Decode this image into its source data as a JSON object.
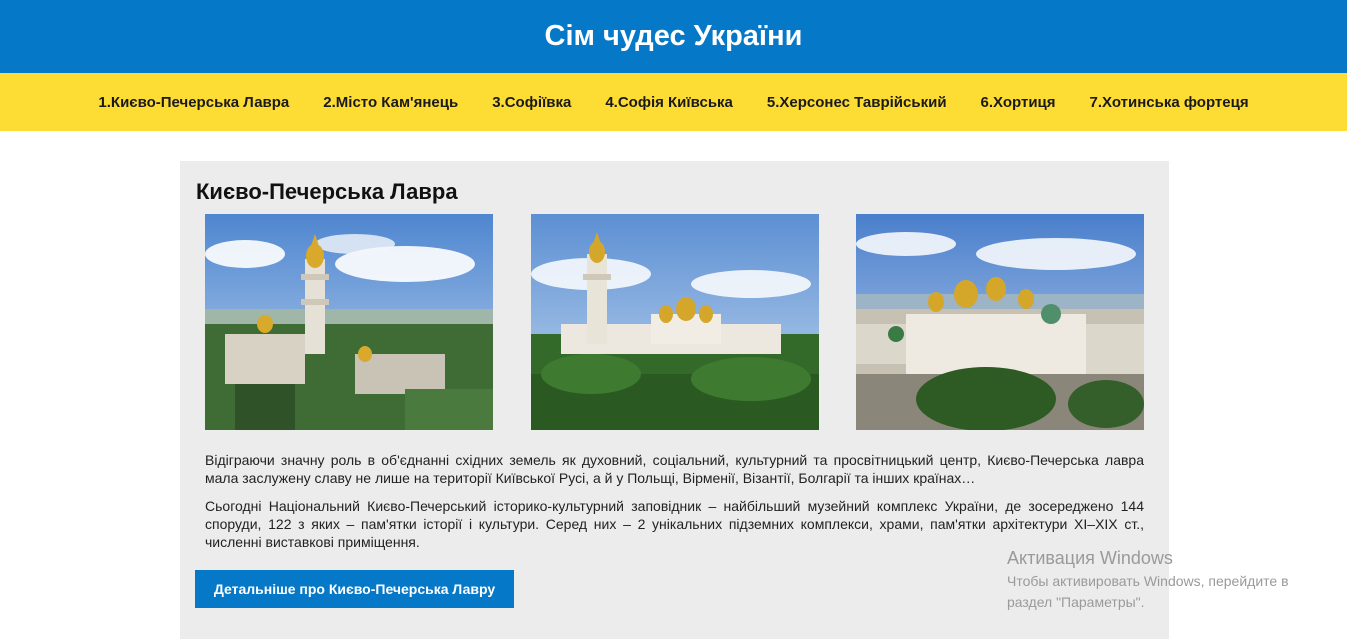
{
  "header": {
    "title": "Сім чудес України"
  },
  "nav": {
    "items": [
      {
        "label": "1.Києво-Печерська Лавра"
      },
      {
        "label": "2.Місто Кам'янець"
      },
      {
        "label": "3.Софіївка"
      },
      {
        "label": "4.Софія Київська"
      },
      {
        "label": "5.Херсонес Таврійський"
      },
      {
        "label": "6.Хортиця"
      },
      {
        "label": "7.Хотинська фортеця"
      }
    ]
  },
  "main": {
    "title": "Києво-Печерська Лавра",
    "paragraphs": [
      "Відіграючи значну роль в об'єднанні східних земель як духовний, соціальний, культурний та просвітницький центр, Києво-Печерська лавра мала заслужену славу не лише на території Київської Русі, а й у Польщі, Вірменії, Візантії, Болгарії та інших країнах…",
      "Сьогодні Національний Києво-Печерський історико-культурний заповідник – найбільший музейний комплекс України, де зосереджено 144 споруди, 122 з яких – пам'ятки історії і культури. Серед них – 2 унікальних підземних комплекси, храми, пам'ятки архітектури XI–XIX ст., численні виставкові приміщення."
    ],
    "button_label": "Детальніше про Києво-Печерська Лавру"
  },
  "watermark": {
    "title": "Активация Windows",
    "line1": "Чтобы активировать Windows, перейдите в",
    "line2": "раздел \"Параметры\"."
  },
  "colors": {
    "header_bg": "#0678c8",
    "nav_bg": "#fddc34",
    "button_bg": "#0678c8",
    "card_bg": "#ececec"
  }
}
